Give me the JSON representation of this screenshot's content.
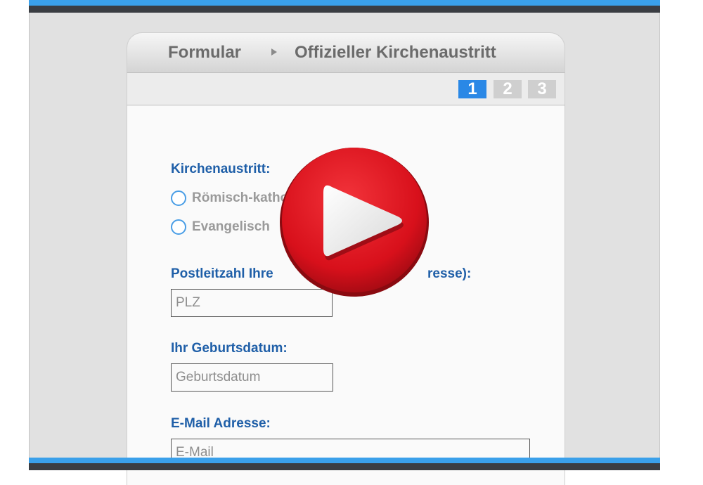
{
  "breadcrumb": {
    "root": "Formular",
    "current": "Offizieller Kirchenaustritt"
  },
  "steps": [
    "1",
    "2",
    "3"
  ],
  "active_step": 1,
  "form": {
    "church_label": "Kirchenaustritt:",
    "options": [
      {
        "label": "Römisch-katho"
      },
      {
        "label": "Evangelisch"
      }
    ],
    "plz_label_left": "Postleitzahl Ihre",
    "plz_label_right": "resse):",
    "plz_placeholder": "PLZ",
    "birth_label": "Ihr Geburtsdatum:",
    "birth_placeholder": "Geburtsdatum",
    "email_label": "E-Mail Adresse:",
    "email_placeholder": "E-Mail"
  },
  "overlay": {
    "icon": "play-icon"
  },
  "colors": {
    "accent_blue": "#2a88e6",
    "label_blue": "#1f5fa8",
    "play_red": "#e3141f"
  }
}
